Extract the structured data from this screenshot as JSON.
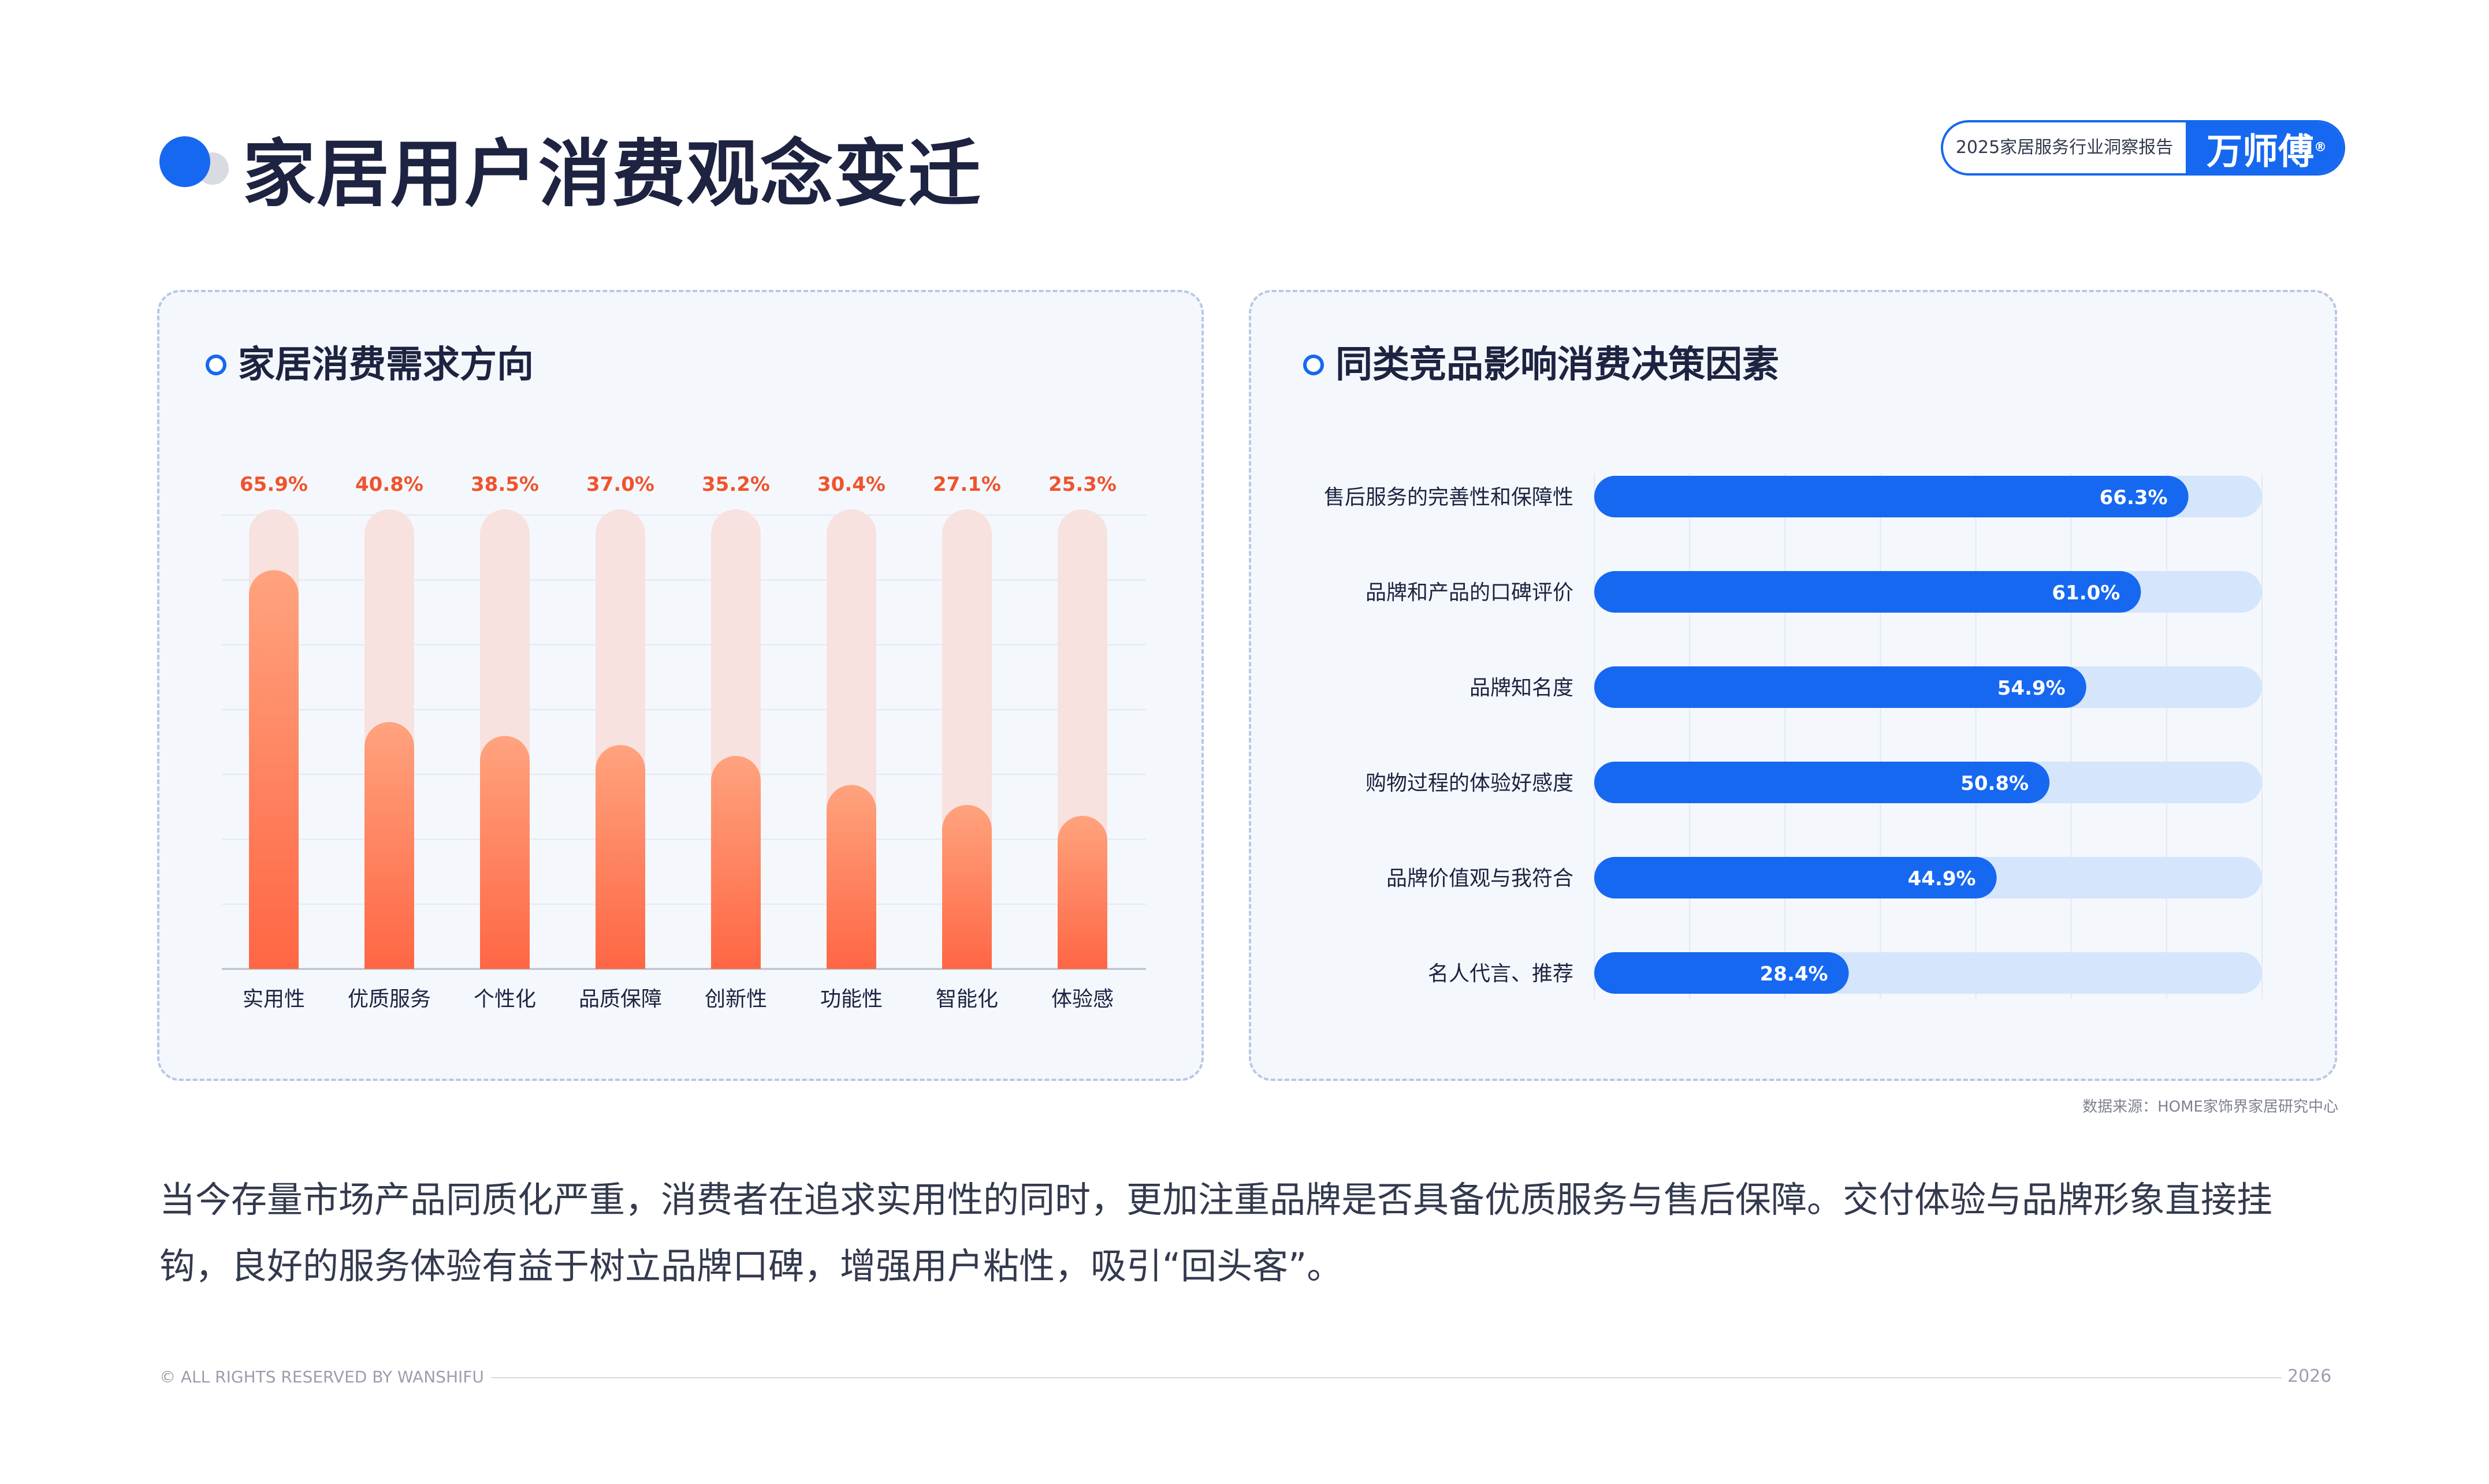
{
  "header": {
    "title": "家居用户消费观念变迁",
    "badge_text": "2025家居服务行业洞察报告",
    "brand": "万师傅",
    "brand_mark": "®"
  },
  "colors": {
    "primary_blue": "#1668f0",
    "light_blue_track": "#d5e5fb",
    "orange_top": "#ffa37e",
    "orange_bottom": "#ff6644",
    "pink_track": "#f7e2df",
    "value_orange": "#f0532d"
  },
  "left_panel": {
    "title": "家居消费需求方向"
  },
  "right_panel": {
    "title": "同类竞品影响消费决策因素"
  },
  "chart_data": [
    {
      "type": "bar",
      "orientation": "vertical",
      "categories": [
        "实用性",
        "优质服务",
        "个性化",
        "品质保障",
        "创新性",
        "功能性",
        "智能化",
        "体验感"
      ],
      "values": [
        65.9,
        40.8,
        38.5,
        37.0,
        35.2,
        30.4,
        27.1,
        25.3
      ],
      "value_labels": [
        "65.9%",
        "40.8%",
        "38.5%",
        "37.0%",
        "35.2%",
        "30.4%",
        "27.1%",
        "25.3%"
      ],
      "ylim": [
        0,
        75
      ],
      "grid": true
    },
    {
      "type": "bar",
      "orientation": "horizontal",
      "categories": [
        "售后服务的完善性和保障性",
        "品牌和产品的口碑评价",
        "品牌知名度",
        "购物过程的体验好感度",
        "品牌价值观与我符合",
        "名人代言、推荐"
      ],
      "values": [
        66.3,
        61.0,
        54.9,
        50.8,
        44.9,
        28.4
      ],
      "value_labels": [
        "66.3%",
        "61.0%",
        "54.9%",
        "50.8%",
        "44.9%",
        "28.4%"
      ],
      "xlim": [
        0,
        70
      ],
      "grid": true
    }
  ],
  "source_note": "数据来源：HOME家饰界家居研究中心",
  "summary": "当今存量市场产品同质化严重，消费者在追求实用性的同时，更加注重品牌是否具备优质服务与售后保障。交付体验与品牌形象直接挂钩，良好的服务体验有益于树立品牌口碑，增强用户粘性，吸引“回头客”。",
  "footer": {
    "copyright": "© ALL RIGHTS RESERVED BY WANSHIFU",
    "year": "2026"
  }
}
